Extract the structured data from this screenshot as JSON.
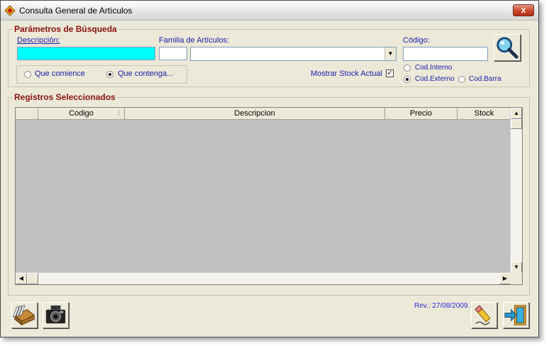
{
  "window": {
    "title": "Consulta General de Artículos",
    "close_label": "x"
  },
  "search_params": {
    "group_title": "Parámetros de Búsqueda",
    "descripcion_label": "Descripción:",
    "descripcion_value": "",
    "familia_label": "Familia de Artículos:",
    "familia_code_value": "",
    "familia_value": "",
    "codigo_label": "Código:",
    "codigo_value": "",
    "match_options": [
      {
        "label": "Que comience",
        "selected": false
      },
      {
        "label": "Que contenga...",
        "selected": true
      }
    ],
    "mostrar_stock_label": "Mostrar Stock Actual",
    "mostrar_stock_checked": true,
    "code_type_options": [
      {
        "label": "Cod.Interno",
        "selected": false
      },
      {
        "label": "Cod.Externo",
        "selected": true
      },
      {
        "label": "Cod.Barra",
        "selected": false
      }
    ]
  },
  "results": {
    "group_title": "Registros Seleccionados",
    "columns": [
      "",
      "Codigo",
      "Descripcion",
      "Precio",
      "Stock"
    ],
    "rows": []
  },
  "footer": {
    "revision": "Rev.: 27/08/2009."
  },
  "icons": {
    "search": "magnifier-icon",
    "files": "file-drawer-icon",
    "camera": "camera-icon",
    "clear": "pencil-eraser-icon",
    "exit": "exit-door-icon"
  },
  "colors": {
    "field_highlight": "#00ffff",
    "label_blue": "#1b1baa",
    "group_red": "#8a1010",
    "grid_bg": "#c0c0c0"
  }
}
